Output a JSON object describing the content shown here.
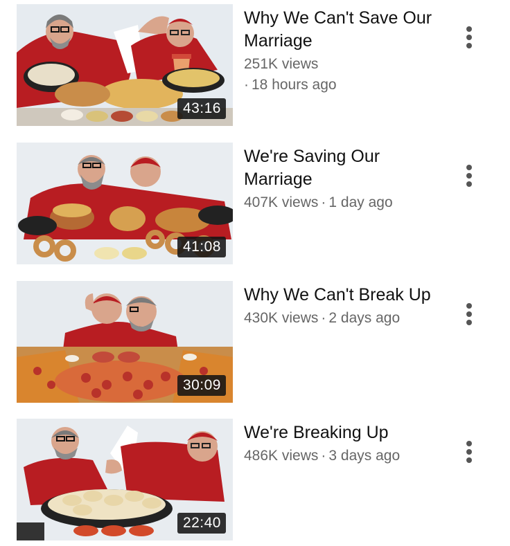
{
  "videos": [
    {
      "title": "Why We Can't Save Our Marriage",
      "views": "251K views",
      "age": "18 hours ago",
      "duration": "43:16",
      "thumb_desc": "two men at a table of fast food"
    },
    {
      "title": "We're Saving Our Marriage",
      "views": "407K views",
      "age": "1 day ago",
      "duration": "41:08",
      "thumb_desc": "two men hugging over burgers and onion rings"
    },
    {
      "title": "Why We Can't Break Up",
      "views": "430K views",
      "age": "2 days ago",
      "duration": "30:09",
      "thumb_desc": "two men kissing over pizza"
    },
    {
      "title": "We're Breaking Up",
      "views": "486K views",
      "age": "3 days ago",
      "duration": "22:40",
      "thumb_desc": "two men arguing over dumplings"
    }
  ],
  "icons": {
    "menu": "more-vertical-icon"
  },
  "colors": {
    "robe_red": "#b81d22",
    "text_secondary": "#666666",
    "duration_bg": "#141414"
  }
}
